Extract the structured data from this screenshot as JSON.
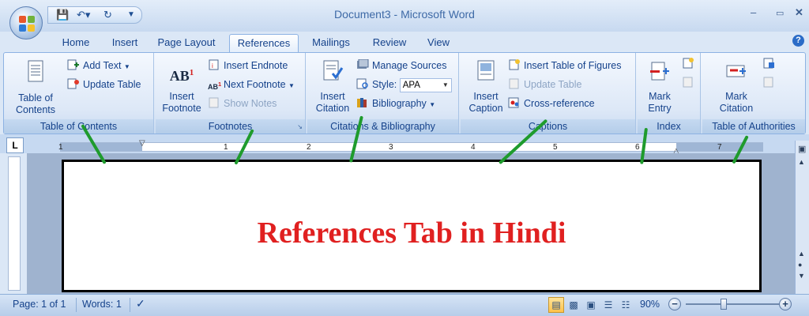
{
  "window": {
    "title": "Document3 - Microsoft Word"
  },
  "quick_access": {
    "save_icon": "save-icon",
    "undo_icon": "undo-icon",
    "redo_icon": "redo-icon",
    "customize_icon": "customize-icon"
  },
  "tabs": [
    {
      "label": "Home"
    },
    {
      "label": "Insert"
    },
    {
      "label": "Page Layout"
    },
    {
      "label": "References"
    },
    {
      "label": "Mailings"
    },
    {
      "label": "Review"
    },
    {
      "label": "View"
    }
  ],
  "ribbon": {
    "toc": {
      "table_of_contents_line1": "Table of",
      "table_of_contents_line2": "Contents",
      "add_text": "Add Text",
      "update_table": "Update Table",
      "group_label": "Table of Contents"
    },
    "footnotes": {
      "insert_footnote_line1": "Insert",
      "insert_footnote_line2": "Footnote",
      "insert_endnote": "Insert Endnote",
      "next_footnote": "Next Footnote",
      "show_notes": "Show Notes",
      "group_label": "Footnotes",
      "ab_glyph": "AB"
    },
    "citations": {
      "insert_citation_line1": "Insert",
      "insert_citation_line2": "Citation",
      "manage_sources": "Manage Sources",
      "style_label": "Style:",
      "style_value": "APA",
      "bibliography": "Bibliography",
      "group_label": "Citations & Bibliography"
    },
    "captions": {
      "insert_caption_line1": "Insert",
      "insert_caption_line2": "Caption",
      "insert_table_of_figures": "Insert Table of Figures",
      "update_table": "Update Table",
      "cross_reference": "Cross-reference",
      "group_label": "Captions"
    },
    "index": {
      "mark_entry_line1": "Mark",
      "mark_entry_line2": "Entry",
      "group_label": "Index"
    },
    "authorities": {
      "mark_citation_line1": "Mark",
      "mark_citation_line2": "Citation",
      "group_label": "Table of Authorities"
    }
  },
  "ruler": {
    "numbers": [
      "1",
      "1",
      "2",
      "3",
      "4",
      "5",
      "6",
      "7"
    ],
    "tab_selector": "L"
  },
  "document": {
    "text": "References Tab in Hindi"
  },
  "status": {
    "page": "Page: 1 of 1",
    "words": "Words: 1",
    "zoom": "90%"
  },
  "colors": {
    "arrow": "#1f9b2d",
    "heading": "#e02020"
  }
}
